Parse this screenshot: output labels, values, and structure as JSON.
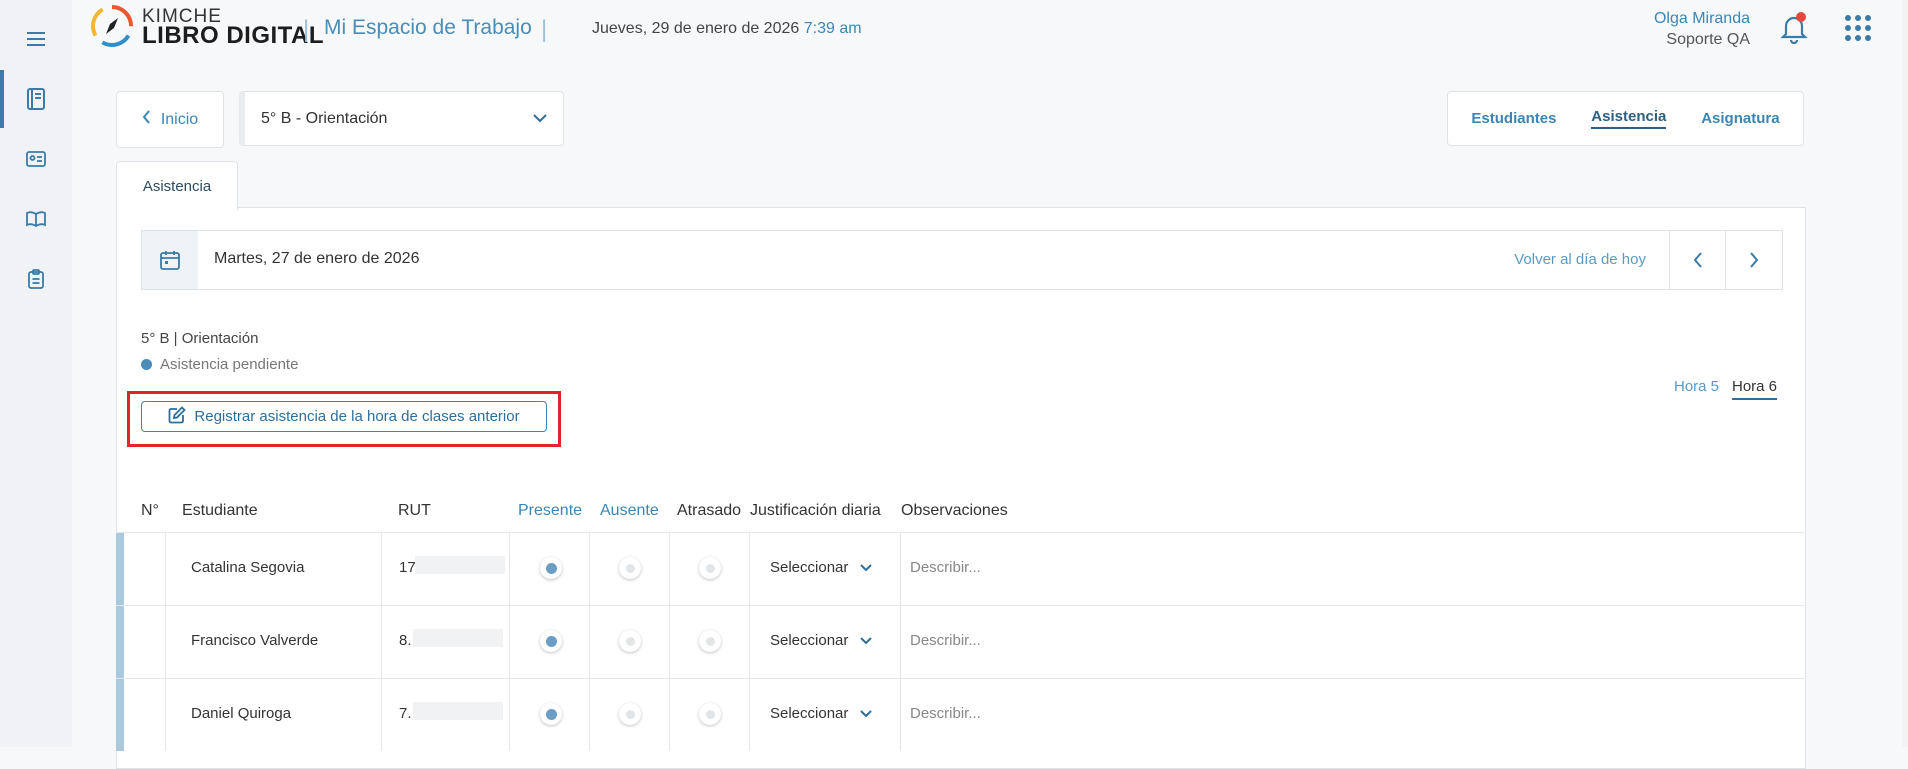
{
  "header": {
    "brand_line1": "KIMCHE",
    "brand_line2": "LIBRO DIGITAL",
    "separator": "|",
    "workspace": "Mi Espacio de Trabajo",
    "date": "Jueves, 29 de enero de 2026",
    "time": "7:39 am",
    "user_name": "Olga Miranda",
    "user_role": "Soporte QA"
  },
  "toolbar": {
    "back_label": "Inicio",
    "course_selected": "5° B - Orientación",
    "tabs": [
      "Estudiantes",
      "Asistencia",
      "Asignatura"
    ],
    "active_tab": "Asistencia"
  },
  "page_tab": "Asistencia",
  "date_bar": {
    "date": "Martes, 27 de enero de 2026",
    "back_today": "Volver al día de hoy"
  },
  "course_line": "5° B | Orientación",
  "status": "Asistencia pendiente",
  "register_button": "Registrar asistencia de la hora de clases anterior",
  "hours": [
    "Hora 5",
    "Hora 6"
  ],
  "table": {
    "headers": [
      "N°",
      "Estudiante",
      "RUT",
      "Presente",
      "Ausente",
      "Atrasado",
      "Justificación diaria",
      "Observaciones"
    ],
    "rows": [
      {
        "name": "Catalina Segovia",
        "rut": "17",
        "justificacion": "Seleccionar",
        "obs_placeholder": "Describir..."
      },
      {
        "name": "Francisco Valverde",
        "rut": "8.",
        "justificacion": "Seleccionar",
        "obs_placeholder": "Describir..."
      },
      {
        "name": "Daniel Quiroga",
        "rut": "7.",
        "justificacion": "Seleccionar",
        "obs_placeholder": "Describir..."
      }
    ]
  },
  "colors": {
    "accent": "#3b86b5",
    "highlight": "#e0262d"
  }
}
